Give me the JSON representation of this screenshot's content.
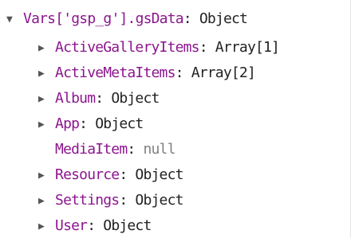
{
  "tree": {
    "root": {
      "expanded": true,
      "key": "Vars['gsp_g'].gsData",
      "value": "Object"
    },
    "children": [
      {
        "key": "ActiveGalleryItems",
        "value": "Array[1]",
        "expandable": true
      },
      {
        "key": "ActiveMetaItems",
        "value": "Array[2]",
        "expandable": true
      },
      {
        "key": "Album",
        "value": "Object",
        "expandable": true
      },
      {
        "key": "App",
        "value": "Object",
        "expandable": true
      },
      {
        "key": "MediaItem",
        "value": "null",
        "expandable": false
      },
      {
        "key": "Resource",
        "value": "Object",
        "expandable": true
      },
      {
        "key": "Settings",
        "value": "Object",
        "expandable": true
      },
      {
        "key": "User",
        "value": "Object",
        "expandable": true
      }
    ]
  },
  "glyphs": {
    "expanded_arrow": "▼",
    "collapsed_arrow": "▶",
    "separator": ": "
  },
  "colors": {
    "key": "#8b168e",
    "value": "#222222",
    "null_value": "#808080"
  }
}
